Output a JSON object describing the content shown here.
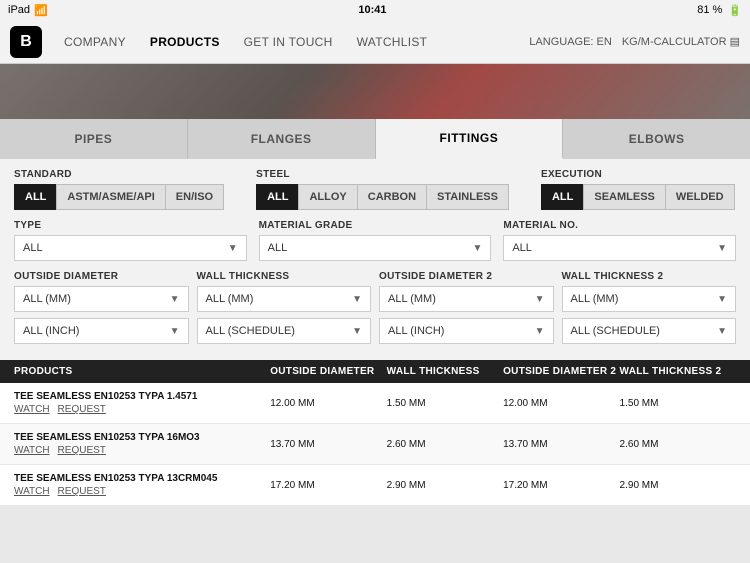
{
  "statusBar": {
    "left": "iPad",
    "time": "10:41",
    "battery": "81 %",
    "wifiIcon": "wifi",
    "batteryIcon": "battery"
  },
  "navbar": {
    "logoText": "B",
    "items": [
      {
        "label": "COMPANY",
        "active": false
      },
      {
        "label": "PRODUCTS",
        "active": true
      },
      {
        "label": "GET IN TOUCH",
        "active": false
      },
      {
        "label": "WATCHLIST",
        "active": false
      }
    ],
    "rightItems": [
      {
        "label": "LANGUAGE: EN"
      },
      {
        "label": "KG/M-CALCULATOR ▤"
      }
    ]
  },
  "tabs": [
    {
      "label": "PIPES",
      "active": false
    },
    {
      "label": "FLANGES",
      "active": false
    },
    {
      "label": "FITTINGS",
      "active": true
    },
    {
      "label": "ELBOWS",
      "active": false
    }
  ],
  "filters": {
    "standard": {
      "label": "STANDARD",
      "buttons": [
        {
          "label": "ALL",
          "active": true
        },
        {
          "label": "ASTM/ASME/API",
          "active": false
        },
        {
          "label": "EN/ISO",
          "active": false
        }
      ]
    },
    "steel": {
      "label": "STEEL",
      "buttons": [
        {
          "label": "ALL",
          "active": true
        },
        {
          "label": "ALLOY",
          "active": false
        },
        {
          "label": "CARBON",
          "active": false
        },
        {
          "label": "STAINLESS",
          "active": false
        }
      ]
    },
    "execution": {
      "label": "EXECUTION",
      "buttons": [
        {
          "label": "ALL",
          "active": true
        },
        {
          "label": "SEAMLESS",
          "active": false
        },
        {
          "label": "WELDED",
          "active": false
        }
      ]
    },
    "type": {
      "label": "TYPE",
      "placeholder": "ALL",
      "value": "ALL"
    },
    "materialGrade": {
      "label": "MATERIAL GRADE",
      "placeholder": "ALL",
      "value": "ALL"
    },
    "materialNo": {
      "label": "MATERIAL NO.",
      "placeholder": "ALL",
      "value": "ALL"
    },
    "outsideDiameter": {
      "label": "OUTSIDE DIAMETER",
      "mmValue": "ALL (MM)",
      "inchValue": "ALL (INCH)"
    },
    "wallThickness": {
      "label": "WALL THICKNESS",
      "mmValue": "ALL (MM)",
      "scheduleValue": "ALL (SCHEDULE)"
    },
    "outsideDiameter2": {
      "label": "OUTSIDE DIAMETER 2",
      "mmValue": "ALL (MM)",
      "inchValue": "ALL (INCH)"
    },
    "wallThickness2": {
      "label": "WALL THICKNESS 2",
      "mmValue": "ALL (MM)",
      "scheduleValue": "ALL (SCHEDULE)"
    }
  },
  "table": {
    "headers": {
      "products": "PRODUCTS",
      "outsideDiameter": "OUTSIDE DIAMETER",
      "wallThickness": "WALL THICKNESS",
      "outsideDiameter2": "OUTSIDE DIAMETER 2",
      "wallThickness2": "WALL THICKNESS 2"
    },
    "rows": [
      {
        "name": "TEE SEAMLESS EN10253 TYPA 1.4571",
        "links": [
          "WATCH",
          "REQUEST"
        ],
        "od": "12.00 MM",
        "wt": "1.50 MM",
        "od2": "12.00 MM",
        "wt2": "1.50 MM"
      },
      {
        "name": "TEE SEAMLESS EN10253 TYPA 16MO3",
        "links": [
          "WATCH",
          "REQUEST"
        ],
        "od": "13.70 MM",
        "wt": "2.60 MM",
        "od2": "13.70 MM",
        "wt2": "2.60 MM"
      },
      {
        "name": "TEE SEAMLESS EN10253 TYPA 13CRM045",
        "links": [
          "WATCH",
          "REQUEST"
        ],
        "od": "17.20 MM",
        "wt": "2.90 MM",
        "od2": "17.20 MM",
        "wt2": "2.90 MM"
      }
    ]
  }
}
